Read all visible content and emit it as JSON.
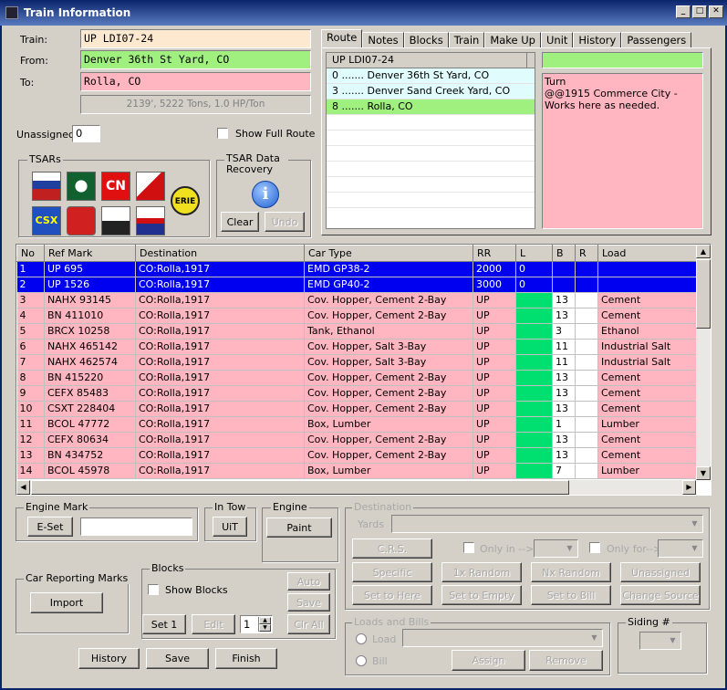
{
  "window": {
    "title": "Train Information",
    "min": "_",
    "max": "□",
    "close": "✕"
  },
  "train": {
    "train_label": "Train:",
    "train_value": "UP LDI07-24",
    "from_label": "From:",
    "from_value": "Denver 36th St Yard, CO",
    "to_label": "To:",
    "to_value": "Rolla, CO",
    "stats": "2139', 5222 Tons, 1.0 HP/Ton"
  },
  "unassigned": {
    "label": "Unassigned",
    "value": "0"
  },
  "show_full_route": "Show Full Route",
  "tsars": {
    "title": "TSARs",
    "icons": [
      "amtrak-tsar-icon",
      "santa-fe-tsar-icon",
      "cn-tsar-icon",
      "cp-tsar-icon",
      "erie-tsar-icon",
      "csx-tsar-icon",
      "kansas-city-southern-tsar-icon",
      "norfolk-southern-tsar-icon",
      "union-pacific-tsar-icon"
    ]
  },
  "tsar_recovery": {
    "title": "TSAR Data Recovery",
    "clear": "Clear",
    "undo": "Undo",
    "info_glyph": "i"
  },
  "tabs": [
    "Route",
    "Notes",
    "Blocks",
    "Train",
    "Make Up",
    "Unit",
    "History",
    "Passengers"
  ],
  "route": {
    "header": "UP LDI07-24",
    "stops": [
      "0 ....... Denver 36th St Yard, CO",
      "3 ....... Denver Sand Creek Yard, CO",
      "8 ....... Rolla, CO"
    ],
    "note_title": "",
    "note_text": "Turn\n@@1915 Commerce City - Works here as needed."
  },
  "grid": {
    "headers": [
      "No",
      "Ref Mark",
      "Destination",
      "Car Type",
      "RR",
      "L",
      "B",
      "R",
      "Load"
    ],
    "rows": [
      [
        "1",
        "UP 695",
        "CO:Rolla,1917",
        "EMD GP38-2",
        "2000",
        "0",
        "",
        "",
        ""
      ],
      [
        "2",
        "UP 1526",
        "CO:Rolla,1917",
        "EMD GP40-2",
        "3000",
        "0",
        "",
        "",
        ""
      ],
      [
        "3",
        "NAHX 93145",
        "CO:Rolla,1917",
        "Cov. Hopper, Cement 2-Bay",
        "UP",
        "",
        "13",
        "",
        "Cement"
      ],
      [
        "4",
        "BN 411010",
        "CO:Rolla,1917",
        "Cov. Hopper, Cement 2-Bay",
        "UP",
        "",
        "13",
        "",
        "Cement"
      ],
      [
        "5",
        "BRCX 10258",
        "CO:Rolla,1917",
        "Tank, Ethanol",
        "UP",
        "",
        "3",
        "",
        "Ethanol"
      ],
      [
        "6",
        "NAHX 465142",
        "CO:Rolla,1917",
        "Cov. Hopper, Salt 3-Bay",
        "UP",
        "",
        "11",
        "",
        "Industrial Salt"
      ],
      [
        "7",
        "NAHX 462574",
        "CO:Rolla,1917",
        "Cov. Hopper, Salt 3-Bay",
        "UP",
        "",
        "11",
        "",
        "Industrial Salt"
      ],
      [
        "8",
        "BN 415220",
        "CO:Rolla,1917",
        "Cov. Hopper, Cement 2-Bay",
        "UP",
        "",
        "13",
        "",
        "Cement"
      ],
      [
        "9",
        "CEFX 85483",
        "CO:Rolla,1917",
        "Cov. Hopper, Cement 2-Bay",
        "UP",
        "",
        "13",
        "",
        "Cement"
      ],
      [
        "10",
        "CSXT 228404",
        "CO:Rolla,1917",
        "Cov. Hopper, Cement 2-Bay",
        "UP",
        "",
        "13",
        "",
        "Cement"
      ],
      [
        "11",
        "BCOL 47772",
        "CO:Rolla,1917",
        "Box, Lumber",
        "UP",
        "",
        "1",
        "",
        "Lumber"
      ],
      [
        "12",
        "CEFX 80634",
        "CO:Rolla,1917",
        "Cov. Hopper, Cement 2-Bay",
        "UP",
        "",
        "13",
        "",
        "Cement"
      ],
      [
        "13",
        "BN 434752",
        "CO:Rolla,1917",
        "Cov. Hopper, Cement 2-Bay",
        "UP",
        "",
        "13",
        "",
        "Cement"
      ],
      [
        "14",
        "BCOL 45978",
        "CO:Rolla,1917",
        "Box, Lumber",
        "UP",
        "",
        "7",
        "",
        "Lumber"
      ]
    ]
  },
  "engine_mark": {
    "title": "Engine Mark",
    "eset": "E-Set",
    "value": ""
  },
  "in_tow": {
    "title": "In Tow",
    "uit": "UiT"
  },
  "engine": {
    "title": "Engine",
    "paint": "Paint"
  },
  "destination": {
    "title": "Destination",
    "yards": "Yards",
    "crs": "C.R.S.",
    "only_in": "Only in -->",
    "only_for": "Only for-->",
    "specific": "Specific",
    "random1": "1x Random",
    "nx_random": "Nx Random",
    "unassigned": "Unassigned",
    "set_here": "Set to Here",
    "set_empty": "Set to Empty",
    "set_bill": "Set to Bill",
    "change_source": "Change Source"
  },
  "car_reporting": {
    "title": "Car Reporting Marks",
    "import": "Import"
  },
  "blocks": {
    "title": "Blocks",
    "show": "Show Blocks",
    "auto": "Auto",
    "save": "Save",
    "set1": "Set 1",
    "edit": "Edit",
    "num": "1",
    "clr_all": "Clr All"
  },
  "loads_bills": {
    "title": "Loads and Bills",
    "load": "Load",
    "bill": "Bill",
    "assign": "Assign",
    "remove": "Remove"
  },
  "siding": {
    "title": "Siding #"
  },
  "bottom": {
    "history": "History",
    "save": "Save",
    "finish": "Finish"
  },
  "colors": {
    "train_bg": "#fde9d0",
    "from_bg": "#a0f080",
    "to_bg": "#ffb6c1",
    "selected": "#0000f0",
    "pink": "#ffb6c1",
    "green": "#00e070"
  }
}
